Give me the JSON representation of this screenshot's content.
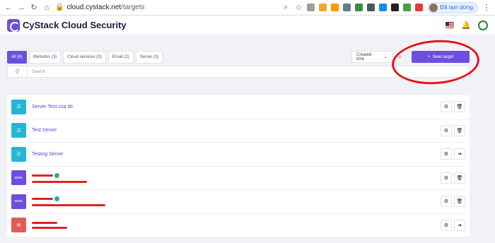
{
  "browser": {
    "url_host": "cloud.cystack.net",
    "url_path": "/targets",
    "profile_label": "Đã tạm dừng"
  },
  "app": {
    "brand": "CyStack Cloud Security",
    "brand_color": "#6c4fe0"
  },
  "filters": [
    {
      "label": "All (6)",
      "active": true
    },
    {
      "label": "Websites (3)",
      "active": false
    },
    {
      "label": "Cloud services (0)",
      "active": false
    },
    {
      "label": "Email (2)",
      "active": false
    },
    {
      "label": "Server (3)",
      "active": false
    }
  ],
  "sort": {
    "label": "Created time",
    "icon": "chevron-down-icon"
  },
  "new_target_button": {
    "label": "New target"
  },
  "search": {
    "placeholder": "Search"
  },
  "targets": [
    {
      "type": "server",
      "name": "Server Test của tôi",
      "actions": [
        "gear-icon",
        "trash-icon"
      ]
    },
    {
      "type": "server",
      "name": "Test Server",
      "actions": [
        "gear-icon",
        "trash-icon"
      ]
    },
    {
      "type": "server",
      "name": "Testing Server",
      "actions": [
        "gear-icon",
        "exit-icon"
      ]
    },
    {
      "type": "website",
      "name": "",
      "verified": true,
      "actions": [
        "gear-icon",
        "trash-icon"
      ]
    },
    {
      "type": "website",
      "name": "",
      "verified": true,
      "actions": [
        "gear-icon",
        "trash-icon"
      ]
    },
    {
      "type": "email",
      "name": "",
      "actions": [
        "gear-icon",
        "exit-icon"
      ]
    }
  ]
}
